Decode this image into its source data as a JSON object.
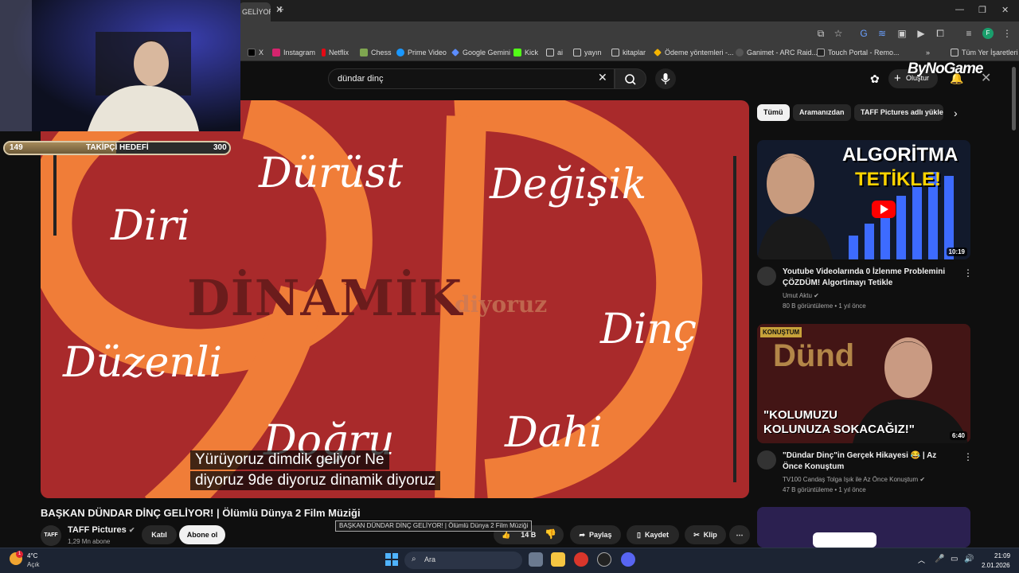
{
  "browser": {
    "tab_title": "GELİYOR",
    "bookmarks": [
      "X",
      "Instagram",
      "Netflix",
      "Chess",
      "Prime Video",
      "Google Gemini",
      "Kick",
      "ai",
      "yayın",
      "kitaplar",
      "Ödeme yöntemleri -...",
      "Ganimet - ARC Raid...",
      "Touch Portal - Remo...",
      "»",
      "Tüm Yer İşaretleri"
    ],
    "profile_initial": "F"
  },
  "youtube": {
    "search_value": "dündar dinç",
    "create_label": "Oluştur",
    "brand_watermark": "ByNoGame"
  },
  "player": {
    "words": [
      "Dürüst",
      "Diri",
      "Değişik",
      "Dinç",
      "Düzenli",
      "Doğru",
      "Dahi"
    ],
    "center_word": "DİNAMİK",
    "ghost_word": "diyoruz",
    "subtitles": [
      "Yürüyoruz dimdik geliyor Ne",
      "diyoruz 9de diyoruz dinamik diyoruz"
    ],
    "colors": {
      "background": "#a92a2b",
      "stripe": "#f07d38",
      "center_text": "#6b1c1c"
    }
  },
  "overlay": {
    "goal_label": "TAKİPÇİ HEDEFİ",
    "current": "149",
    "target": "300",
    "progress_fraction": 0.497
  },
  "video": {
    "title": "BAŞKAN DÜNDAR DİNÇ GELİYOR! | Ölümlü Dünya 2 Film Müziği",
    "tooltip": "BAŞKAN DÜNDAR DİNÇ GELİYOR! | Ölümlü Dünya 2 Film Müziği",
    "channel_avatar_text": "TAFF",
    "channel_name": "TAFF Pictures",
    "subscribers": "1,29 Mn abone",
    "join_label": "Katıl",
    "subscribe_label": "Abone ol",
    "likes": "14 B",
    "share_label": "Paylaş",
    "save_label": "Kaydet",
    "clip_label": "Klip"
  },
  "sidebar": {
    "chips": [
      "Tümü",
      "Aramanızdan",
      "TAFF Pictures adlı yükle"
    ],
    "recs": [
      {
        "thumb_text_1": "ALGORİTMA",
        "thumb_text_2": "TETİKLE!",
        "duration": "10:19",
        "title": "Youtube Videolarında 0 İzlenme Problemini ÇÖZDÜM! Algortimayı Tetikle",
        "channel": "Umut Aktu",
        "meta": "80 B görüntüleme • 1 yıl önce"
      },
      {
        "thumb_badge": "KONUŞTUM",
        "thumb_bg_text": "Dünd",
        "thumb_text_1": "\"KOLUMUZU",
        "thumb_text_2": "KOLUNUZA SOKACAĞIZ!\"",
        "duration": "6:40",
        "title": "\"Dündar Dinç\"in Gerçek Hikayesi 😂 | Az Önce Konuştum",
        "channel": "TV100 Candaş Tolga Işık ile Az Önce Konuştum",
        "meta": "47 B görüntüleme • 1 yıl önce"
      }
    ]
  },
  "taskbar": {
    "weather_temp": "4°C",
    "weather_desc": "Açık",
    "weather_badge": "1",
    "search_placeholder": "Ara",
    "time": "21:09",
    "date": "2.01.2026"
  }
}
